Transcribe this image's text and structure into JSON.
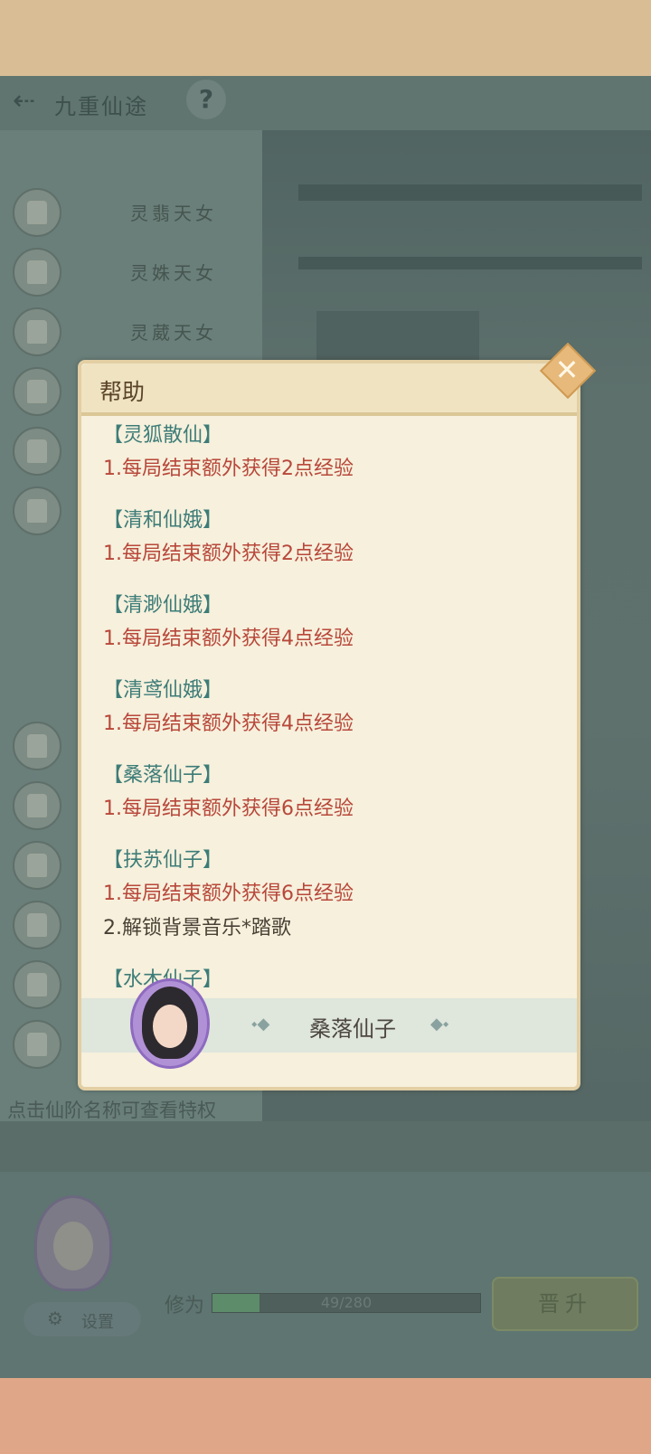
{
  "header": {
    "title": "九重仙途",
    "help_symbol": "?",
    "back_symbol": "⇠"
  },
  "ranks": [
    {
      "name": "灵翡天女"
    },
    {
      "name": "灵姝天女"
    },
    {
      "name": "灵葳天女"
    }
  ],
  "hint_text": "点击仙阶名称可查看特权",
  "settings_label": "设置",
  "xiuwei": {
    "label": "修为",
    "progress_text": "49/280",
    "fraction": 0.175
  },
  "promote_label": "晋升",
  "dialog": {
    "title": "帮助",
    "close_symbol": "✕",
    "entries": [
      {
        "name": "【灵狐散仙】",
        "lines": [
          "1.每局结束额外获得2点经验"
        ]
      },
      {
        "name": "【清和仙娥】",
        "lines": [
          "1.每局结束额外获得2点经验"
        ]
      },
      {
        "name": "【清渺仙娥】",
        "lines": [
          "1.每局结束额外获得4点经验"
        ]
      },
      {
        "name": "【清鸢仙娥】",
        "lines": [
          "1.每局结束额外获得4点经验"
        ]
      },
      {
        "name": "【桑落仙子】",
        "lines": [
          "1.每局结束额外获得6点经验"
        ]
      },
      {
        "name": "【扶苏仙子】",
        "lines": [
          "1.每局结束额外获得6点经验",
          "2.解锁背景音乐*踏歌"
        ]
      },
      {
        "name": "【水木仙子】",
        "lines": []
      }
    ],
    "current_rank": "桑落仙子",
    "deco_left": "⬩◆",
    "deco_right": "◆⬩"
  }
}
